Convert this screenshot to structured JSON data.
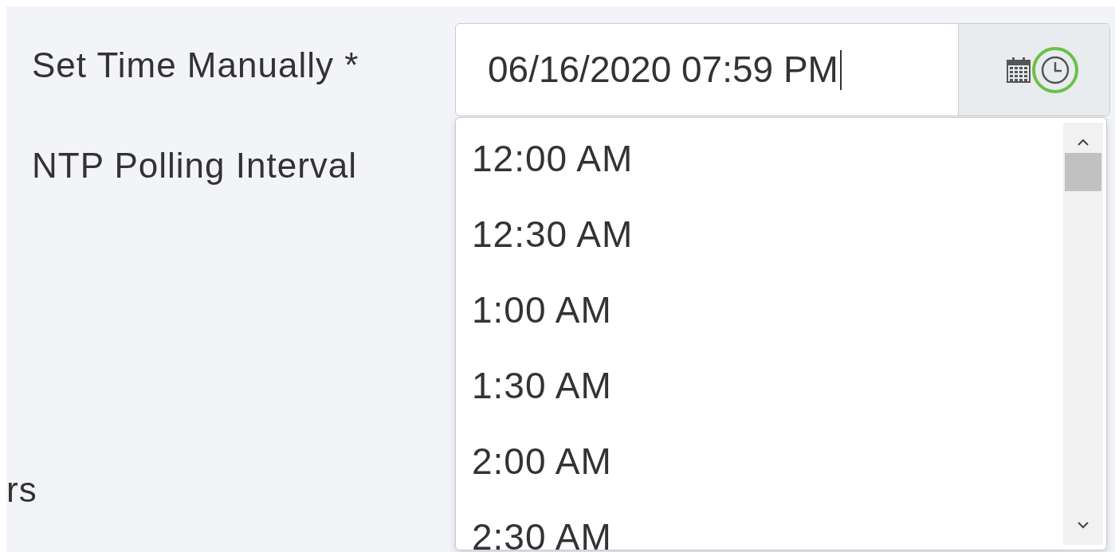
{
  "form": {
    "rows": [
      {
        "label": "Set Time Manually *"
      },
      {
        "label": "NTP Polling Interval"
      }
    ],
    "cut_label": "rs"
  },
  "datetime_field": {
    "value": "06/16/2020 07:59 PM",
    "calendar_button": {
      "highlighted": false
    },
    "clock_button": {
      "highlighted": true
    }
  },
  "time_list": {
    "items": [
      {
        "label": "12:00 AM"
      },
      {
        "label": "12:30 AM"
      },
      {
        "label": "1:00 AM"
      },
      {
        "label": "1:30 AM"
      },
      {
        "label": "2:00 AM"
      },
      {
        "label": "2:30 AM"
      }
    ]
  }
}
